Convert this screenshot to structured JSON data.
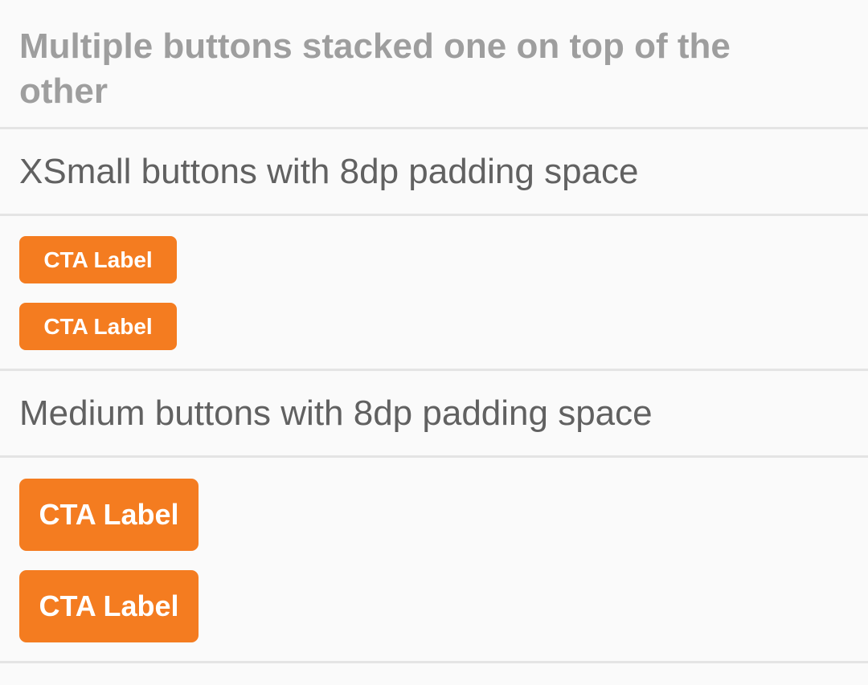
{
  "page": {
    "title": "Multiple buttons stacked one on top of the other"
  },
  "sections": [
    {
      "header": "XSmall buttons with 8dp padding space",
      "buttons": [
        {
          "label": "CTA Label"
        },
        {
          "label": "CTA Label"
        }
      ]
    },
    {
      "header": "Medium buttons with 8dp padding space",
      "buttons": [
        {
          "label": "CTA Label"
        },
        {
          "label": "CTA Label"
        }
      ]
    }
  ],
  "colors": {
    "accent": "#f47c20",
    "background": "#fafafa",
    "divider": "#e4e4e4",
    "title_text": "#9e9e9e",
    "header_text": "#616161",
    "button_text": "#ffffff"
  }
}
